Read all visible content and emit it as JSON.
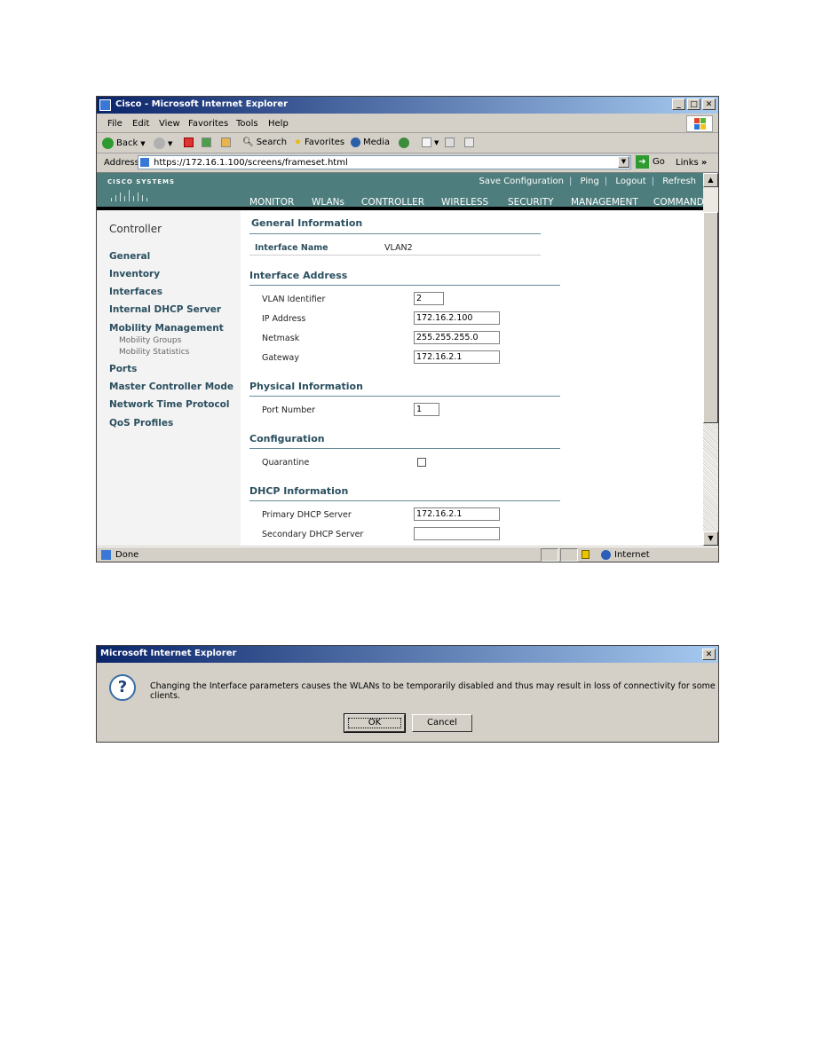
{
  "ie_window": {
    "title": "Cisco - Microsoft Internet Explorer",
    "menu": [
      "File",
      "Edit",
      "View",
      "Favorites",
      "Tools",
      "Help"
    ],
    "toolbar": {
      "back": "Back",
      "search": "Search",
      "favorites": "Favorites",
      "media": "Media"
    },
    "address_label": "Address",
    "url": "https://172.16.1.100/screens/frameset.html",
    "go_label": "Go",
    "links_label": "Links",
    "status": {
      "text": "Done",
      "zone": "Internet"
    }
  },
  "wlc": {
    "brand": "CISCO SYSTEMS",
    "top_links": [
      "Save Configuration",
      "Ping",
      "Logout",
      "Refresh"
    ],
    "tabs": [
      "MONITOR",
      "WLANs",
      "CONTROLLER",
      "WIRELESS",
      "SECURITY",
      "MANAGEMENT",
      "COMMANDS"
    ],
    "active_tab": "CONTROLLER",
    "sidebar": {
      "title": "Controller",
      "items": [
        "General",
        "Inventory",
        "Interfaces",
        "Internal DHCP Server",
        "Mobility Management",
        "Ports",
        "Master Controller Mode",
        "Network Time Protocol",
        "QoS Profiles"
      ],
      "subitems": [
        "Mobility Groups",
        "Mobility Statistics"
      ]
    },
    "general_info": {
      "heading": "General Information",
      "interface_name_label": "Interface Name",
      "interface_name": "VLAN2"
    },
    "interface_address": {
      "heading": "Interface Address",
      "vlan_id_label": "VLAN Identifier",
      "vlan_id": "2",
      "ip_label": "IP Address",
      "ip": "172.16.2.100",
      "netmask_label": "Netmask",
      "netmask": "255.255.255.0",
      "gateway_label": "Gateway",
      "gateway": "172.16.2.1"
    },
    "physical_info": {
      "heading": "Physical Information",
      "port_label": "Port Number",
      "port": "1"
    },
    "configuration": {
      "heading": "Configuration",
      "quarantine_label": "Quarantine",
      "quarantine_checked": false
    },
    "dhcp_info": {
      "heading": "DHCP Information",
      "primary_label": "Primary DHCP Server",
      "primary": "172.16.2.1",
      "secondary_label": "Secondary DHCP Server",
      "secondary": ""
    }
  },
  "dialog": {
    "title": "Microsoft Internet Explorer",
    "message": "Changing the Interface parameters causes the WLANs to be temporarily disabled and thus may result in loss of connectivity for some clients.",
    "ok_label": "OK",
    "cancel_label": "Cancel"
  },
  "colors": {
    "banner": "#4e7d7d",
    "active_tab_underline": "#e89a1e",
    "heading": "#2a4f5f"
  }
}
